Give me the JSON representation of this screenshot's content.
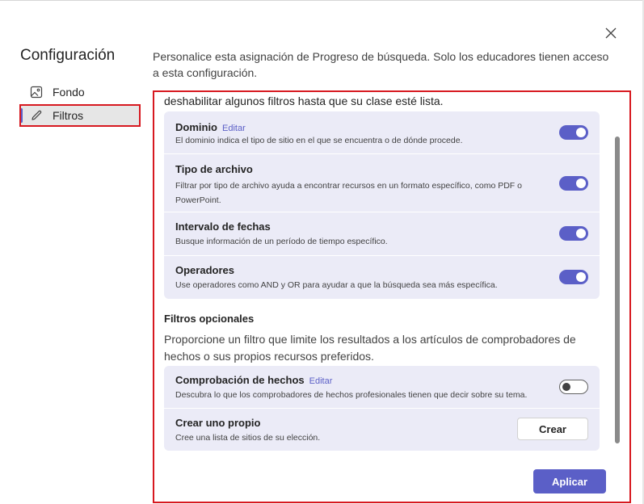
{
  "close_label": "×",
  "nav": {
    "title": "Configuración",
    "items": [
      {
        "label": "Fondo",
        "icon": "image-icon"
      },
      {
        "label": "Filtros",
        "icon": "pencil-icon",
        "selected": true
      }
    ]
  },
  "intro": "Personalice esta asignación de Progreso de búsqueda. Solo los educadores tienen acceso a esta configuración.",
  "content": {
    "cut_text": "deshabilitar algunos filtros hasta que su clase esté lista.",
    "filters": [
      {
        "title": "Dominio",
        "edit": "Editar",
        "desc": "El dominio indica el tipo de sitio en el que se encuentra o de dónde procede.",
        "enabled": true
      },
      {
        "title": "Tipo de archivo",
        "desc": "Filtrar por tipo de archivo ayuda a encontrar recursos en un formato específico, como PDF o PowerPoint.",
        "enabled": true
      },
      {
        "title": "Intervalo de fechas",
        "desc": "Busque información de un período de tiempo específico.",
        "enabled": true
      },
      {
        "title": "Operadores",
        "desc": "Use operadores como AND y OR para ayudar a que la búsqueda sea más específica.",
        "enabled": true
      }
    ],
    "optional": {
      "title": "Filtros opcionales",
      "desc": "Proporcione un filtro que limite los resultados a los artículos de comprobadores de hechos o sus propios recursos preferidos.",
      "items": [
        {
          "title": "Comprobación de hechos",
          "edit": "Editar",
          "desc": "Descubra lo que los comprobadores de hechos profesionales tienen que decir sobre su tema.",
          "enabled": false
        },
        {
          "title": "Crear uno propio",
          "desc": "Cree una lista de sitios de su elección.",
          "button": "Crear"
        }
      ]
    }
  },
  "apply_label": "Aplicar",
  "colors": {
    "accent": "#5b5fc7",
    "highlight": "#d71920",
    "card": "#ebebf7"
  }
}
